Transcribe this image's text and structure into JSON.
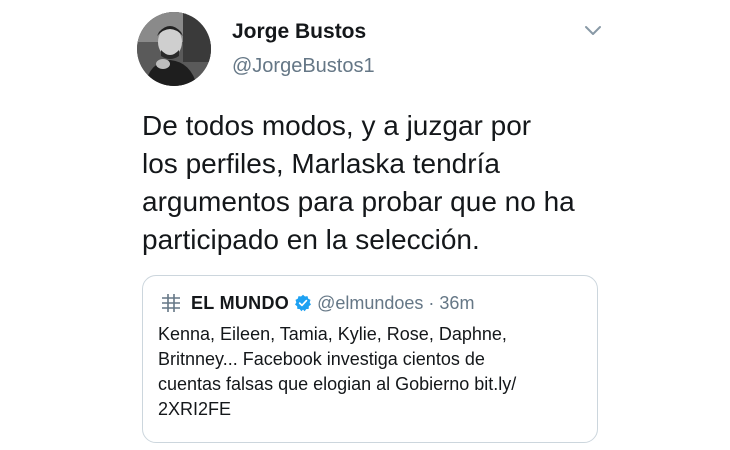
{
  "author": {
    "name": "Jorge Bustos",
    "handle": "@JorgeBustos1"
  },
  "tweet": {
    "lines": [
      "De todos modos, y a juzgar por",
      "los perfiles, Marlaska tendría",
      "argumentos para probar que no ha",
      "participado en la selección."
    ]
  },
  "quoted_tweet": {
    "name": "EL MUNDO",
    "handle": "@elmundoes",
    "separator": "·",
    "time": "36m",
    "lines": [
      "Kenna, Eileen, Tamia, Kylie, Rose, Daphne,",
      "Britnney... Facebook investiga cientos de",
      "cuentas falsas que elogian al Gobierno bit.ly/",
      "2XRI2FE"
    ]
  },
  "icons": {
    "menu": "chevron-down-icon",
    "verified": "verified-badge-icon",
    "logo": "el-mundo-logo-icon"
  },
  "colors": {
    "text": "#14171a",
    "secondary": "#657786",
    "border": "#ccd6dd",
    "verified": "#1da1f2"
  }
}
